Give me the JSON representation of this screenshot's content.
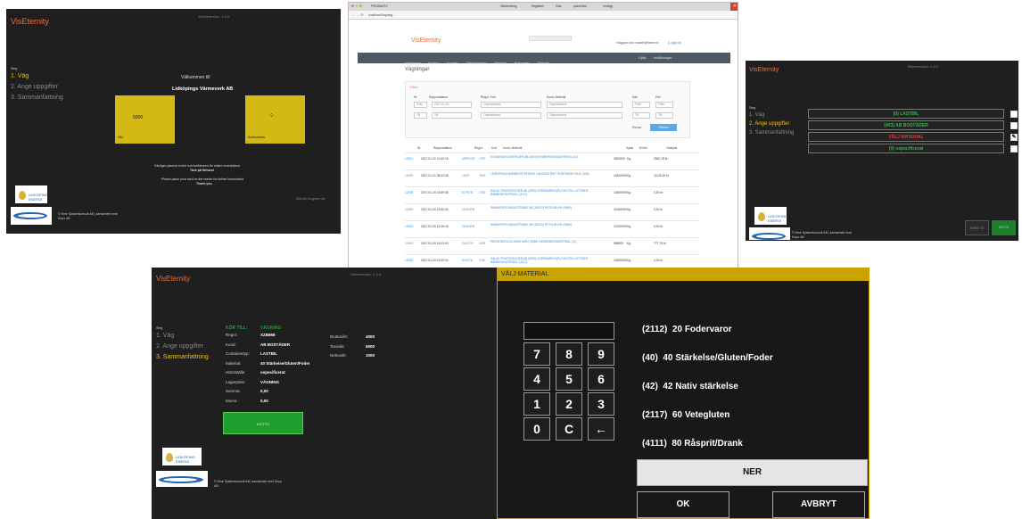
{
  "s1": {
    "brand": "VisEternity",
    "version": "Klientversion: 1.3.0",
    "step_caption": "Steg",
    "steps": [
      "1. Väg",
      "2. Ange uppgifter",
      "3. Sammanfattning"
    ],
    "welcome": "Välkommen till",
    "company": "Lidköpings Värmeverk AB",
    "weight_value": "5000",
    "weight_label": "Vikt",
    "card_label": "Kortnummer",
    "instruction_sv": "Vänligen placera kortet mot kortläsaren för vidare instruktioner",
    "thanks_sv": "Tack på förhand",
    "instruction_en": "Please place your card on the reader for further instructions",
    "thanks_en": "Thank you.",
    "reader_status": "Mitt kort fungerar inte",
    "logo_text": "LIDKÖPING ENERGI",
    "copyright": "© Nine Systemkonsult AB | samarbete med Enpo AB"
  },
  "s2": {
    "tab_title": "PROBATIV",
    "bookmarks": [
      "Hälsentäring",
      "Registrier",
      "Visa",
      "quickView",
      "Verktyg"
    ],
    "url": "localhost/Vagning",
    "brand": "VisEternity",
    "logged_in": "Inloggad som: master@foster.se",
    "logout": "(Logga ut)",
    "nav": [
      "Vägningar",
      "Fordon",
      "Kunder",
      "Deklarationer",
      "Material",
      "Rapporter",
      "Statistik"
    ],
    "nav_right": [
      "Hjälp",
      "Inställningar"
    ],
    "page_title": "Vägningar",
    "filter_title": "Filter",
    "filter_labels": [
      "Nr",
      "Rapportdatum",
      "Regnr, Kort",
      "Kund, Material",
      "Mät",
      "Pris"
    ],
    "row1": [
      "Från",
      "2017-01-01",
      "Ospecificerat",
      "Ospecificerat",
      "Från",
      "Från"
    ],
    "row2": [
      "Till",
      "Till",
      "Ospecificerat",
      "Ospecificerat",
      "Till",
      "Till"
    ],
    "reset": "Rensa",
    "filter_btn": "Filtrera",
    "col_headers": [
      "Nr",
      "Rapportdatum",
      "Regnr",
      "Kort",
      "Kund, Material",
      "Inpan",
      "Enhet",
      "Totalpris"
    ],
    "rows": [
      [
        "12001",
        "2017-01-21 10:42:18",
        "URPX232",
        "1757",
        "SODANGEN-ENERGIER AB (30019) HÄRDNINGSMATERIAL (11)",
        "2600000",
        "Kg",
        "2562,78 kr"
      ],
      [
        "12000",
        "2017-01-21 08:13:26",
        "LIKIS",
        "7543",
        "LENDPRAIG-BARBROS REDIKIK LÄNGDELIEST SORTIMENT BUC (308)",
        "10810000",
        "Kg",
        "11140,20 kr"
      ],
      [
        "12008",
        "2017-01-20 16:49:48",
        "KLP076",
        "1752",
        "SALAY FRATROSCHER AB (3090) JORDBARIKO(R) FACTEN, LATTNER BAMBOUFASTRACL (3117)",
        "14640000",
        "Kg",
        "0,00 kr"
      ],
      [
        "12009",
        "2017-01-20 15:30:42",
        "CDCHEN",
        "",
        "SMAMFORS-INDUSTRIMAT AB (30020) RYTVUR-KIK (9080)",
        "21160000",
        "Kg",
        "0,00 kr"
      ],
      [
        "12003",
        "2017-01-20 15:16:18",
        "CDCHEN",
        "",
        "SMAMFORS-INDUSTRIMAT AB (30020) RYTVUR-KIK (9080)",
        "12100000",
        "Kg",
        "0,00 kr"
      ],
      [
        "12002",
        "2017-01-20 15:13:00",
        "GLD776",
        "1578",
        "PERSLIDHOLM LIMMTIARN (3088) HÄRDNINGSMATERIAL (11)",
        "985000",
        "Kg",
        "777,79 kr"
      ],
      [
        "12002",
        "2017-01-20 14:09:04",
        "KLP076",
        "1760",
        "SALAY FRATROSCHER AB (3090) JORDBARIKO(R) FACTEN, LATTNER BAMBOUFASTRACL (3117)",
        "14200000",
        "Kg",
        "0,00 kr"
      ],
      [
        "12000",
        "2017-01-20 14:09:13",
        "UKSBTN",
        "",
        "NORRÖRA (GÖTTIKRÖN ENTREPRENAD AB (3088) HÄRDNINGSMATERIAL (11)",
        "2380000",
        "Kg",
        "2543,80 kr"
      ]
    ],
    "clock_time": "14:55",
    "clock_date": "2017-01-21"
  },
  "s3": {
    "brand": "VisEternity",
    "version": "Klientversion: 1.3.0",
    "step_caption": "Steg",
    "steps": [
      "1. Väg",
      "2. Ange uppgifter",
      "3. Sammanfattning"
    ],
    "options": [
      "(0) LASTBIL",
      "(403) AB BOSTÄDER",
      "VÄLJ MATERIAL",
      "(0) ospecificerat"
    ],
    "option_colors": [
      "#37b24d",
      "#37b24d",
      "#e53935",
      "#37b24d"
    ],
    "btn_cancel": "AVBRYTA",
    "btn_next": "NÄSTA",
    "logo_text": "LIDKÖPING ENERGI",
    "copyright": "© Nine Systemkonsult AB | samarbete med Enpo AB"
  },
  "s4": {
    "brand": "VisEternity",
    "version": "Klientversion: 1.3.0",
    "step_caption": "Steg",
    "steps": [
      "1. Väg",
      "2. Ange uppgifter",
      "3. Sammanfattning"
    ],
    "heading": "KÖR TILL:",
    "heading_value": "VÄGNING",
    "labels": [
      "Regnr:",
      "Kund:",
      "Containertyp:",
      "Material:",
      "Hämtställe:",
      "Lagerplats:",
      "Summa:",
      "Moms:"
    ],
    "values": [
      "XZB868",
      "AB BOSTÄDER",
      "LASTBIL",
      "40 Stärkelse/Gluten/Foder",
      "ospecificerat",
      "VÄGNING",
      "0,00",
      "0,00"
    ],
    "w_labels": [
      "Bruttovikt:",
      "Taravikt:",
      "Nettovikt:"
    ],
    "w_values": [
      "4000",
      "5000",
      "1000"
    ],
    "receipt": "KVITTO",
    "logo_text": "LIDKÖPING ENERGI",
    "copyright": "© Nine Systemkonsult AB | samarbete med Enpo AB"
  },
  "s5": {
    "title": "VÄLJ MATERIAL",
    "display": "",
    "keys": [
      "7",
      "8",
      "9",
      "4",
      "5",
      "6",
      "1",
      "2",
      "3",
      "0",
      "C",
      "←"
    ],
    "materials": [
      "(2112)  20 Fodervaror",
      "(40)  40 Stärkelse/Gluten/Foder",
      "(42)  42 Nativ stärkelse",
      "(2117)  60 Vetegluten",
      "(4111)  80 Råsprit/Drank"
    ],
    "down": "NER",
    "ok": "OK",
    "cancel": "AVBRYT"
  },
  "colors": {
    "accent": "#e9703e",
    "yellow": "#d4b814",
    "green": "#1e9e2e",
    "gold_border": "#c9a400"
  }
}
